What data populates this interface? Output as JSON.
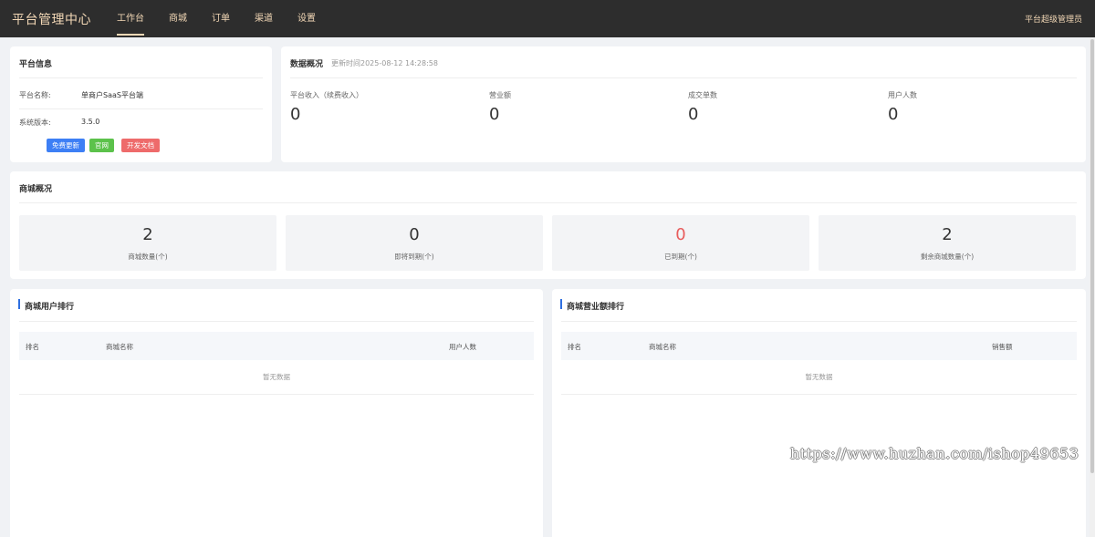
{
  "header": {
    "brand": "平台管理中心",
    "nav": [
      "工作台",
      "商城",
      "订单",
      "渠道",
      "设置"
    ],
    "user": "平台超级管理员"
  },
  "platform_info": {
    "title": "平台信息",
    "name_label": "平台名称:",
    "name_value": "单商户SaaS平台端",
    "version_label": "系统版本:",
    "version_value": "3.5.0",
    "buttons": [
      {
        "label": "免费更新",
        "color": "#3d7ff5"
      },
      {
        "label": "官网",
        "color": "#5cc24b"
      },
      {
        "label": "开发文档",
        "color": "#ee6b6b"
      }
    ]
  },
  "data_overview": {
    "title": "数据概况",
    "updated": "更新时间2025-08-12 14:28:58",
    "stats": [
      {
        "label": "平台收入（续费收入）",
        "value": "0"
      },
      {
        "label": "营业额",
        "value": "0"
      },
      {
        "label": "成交单数",
        "value": "0"
      },
      {
        "label": "用户人数",
        "value": "0"
      }
    ]
  },
  "shop_overview": {
    "title": "商城概况",
    "items": [
      {
        "value": "2",
        "label": "商城数量(个)",
        "color": "#333333"
      },
      {
        "value": "0",
        "label": "即将到期(个)",
        "color": "#333333"
      },
      {
        "value": "0",
        "label": "已到期(个)",
        "color": "#e85c5c"
      },
      {
        "value": "2",
        "label": "剩余商城数量(个)",
        "color": "#333333"
      }
    ]
  },
  "user_rank": {
    "title": "商城用户排行",
    "columns": [
      "排名",
      "商城名称",
      "用户人数"
    ],
    "empty": "暂无数据"
  },
  "sales_rank": {
    "title": "商城营业额排行",
    "columns": [
      "排名",
      "商城名称",
      "销售额"
    ],
    "empty": "暂无数据"
  },
  "watermark": "https://www.huzhan.com/ishop49653"
}
